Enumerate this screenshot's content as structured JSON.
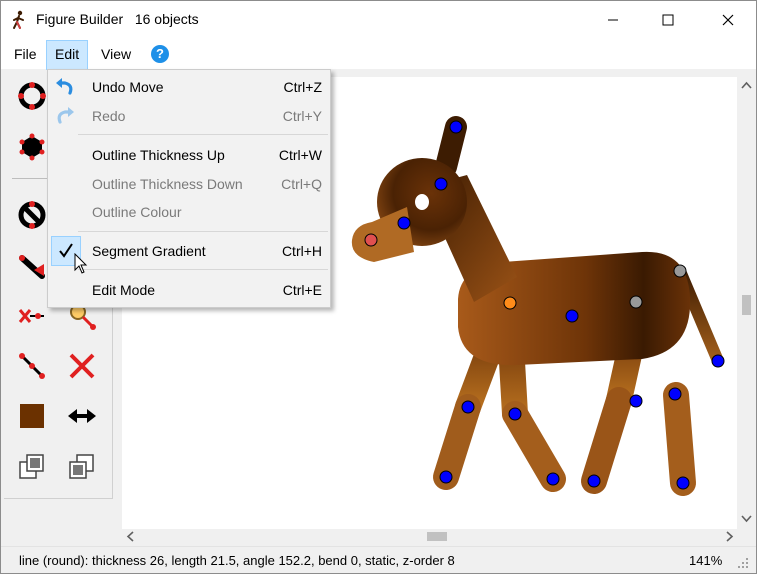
{
  "window": {
    "title": "Figure Builder",
    "object_count": "16 objects",
    "controls": {
      "minimize": "minimize-icon",
      "maximize": "maximize-icon",
      "close": "close-icon"
    }
  },
  "menubar": {
    "items": [
      "File",
      "Edit",
      "View"
    ],
    "active": "Edit",
    "help_icon": "?"
  },
  "edit_menu": {
    "items": [
      {
        "label": "Undo Move",
        "shortcut": "Ctrl+Z",
        "enabled": true,
        "icon": "undo-icon"
      },
      {
        "label": "Redo",
        "shortcut": "Ctrl+Y",
        "enabled": false,
        "icon": "redo-icon"
      },
      {
        "label": "Outline Thickness Up",
        "shortcut": "Ctrl+W",
        "enabled": true
      },
      {
        "label": "Outline Thickness Down",
        "shortcut": "Ctrl+Q",
        "enabled": false
      },
      {
        "label": "Outline Colour",
        "shortcut": "",
        "enabled": false
      },
      {
        "label": "Segment Gradient",
        "shortcut": "Ctrl+H",
        "enabled": true,
        "checked": true
      },
      {
        "label": "Edit Mode",
        "shortcut": "Ctrl+E",
        "enabled": true
      }
    ]
  },
  "toolbar": {
    "tools": [
      "add-circle-tool-icon",
      "add-polygon-tool-icon",
      "no-circle-tool-icon",
      "arrow-tool-icon",
      "line-tool-icon",
      "magnifier-tool-icon",
      "bend-line-tool-icon",
      "delete-tool-icon",
      "colour-swatch-tool-icon",
      "swap-tool-icon",
      "bring-forward-tool-icon",
      "send-backward-tool-icon"
    ]
  },
  "colors": {
    "accent": "#1e90e8",
    "menu_highlight": "#cce8ff",
    "figure_dark": "#3d1c02",
    "figure_mid": "#7a3d0a",
    "figure_light": "#c07830",
    "joint_blue": "#0000ff",
    "joint_orange": "#ff8c1a",
    "joint_red": "#e05050",
    "joint_grey": "#999999",
    "swatch": "#6b3100"
  },
  "status": {
    "text": "line (round): thickness 26, length 21.5, angle 152.2, bend 0, static, z-order 8",
    "zoom": "141%"
  }
}
